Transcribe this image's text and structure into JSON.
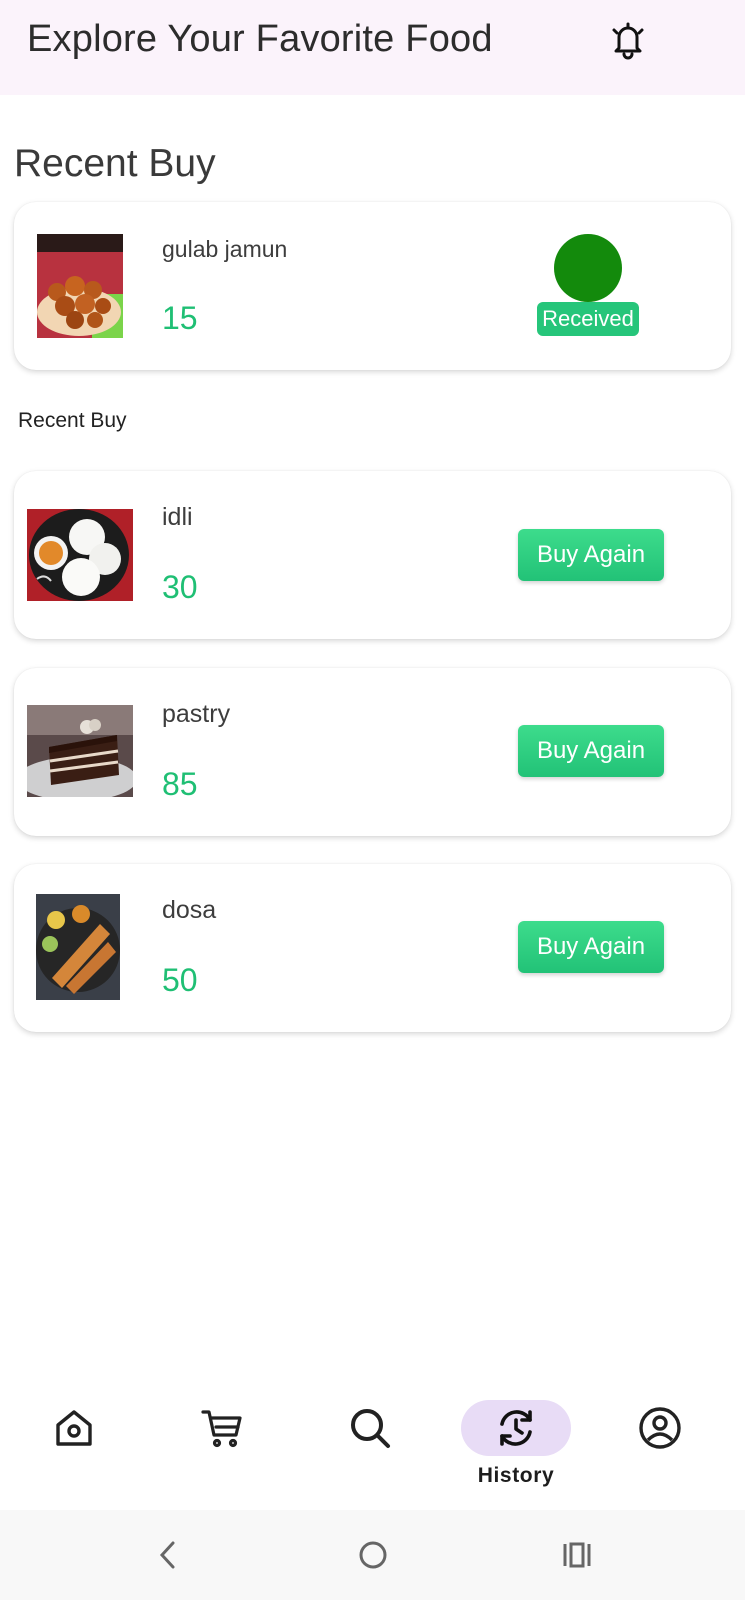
{
  "header": {
    "title": "Explore Your Favorite Food",
    "bell_icon": "bell-icon"
  },
  "recent": {
    "title": "Recent Buy",
    "item": {
      "name": "gulab jamun",
      "price": "15",
      "status": "Received",
      "status_dot_color": "#138a0c"
    }
  },
  "history": {
    "subtitle": "Recent Buy",
    "items": [
      {
        "name": "idli",
        "price": "30",
        "button": "Buy Again"
      },
      {
        "name": "pastry",
        "price": "85",
        "button": "Buy Again"
      },
      {
        "name": "dosa",
        "price": "50",
        "button": "Buy Again"
      }
    ]
  },
  "nav": {
    "items": [
      {
        "icon": "home-icon",
        "label": ""
      },
      {
        "icon": "cart-icon",
        "label": ""
      },
      {
        "icon": "search-icon",
        "label": ""
      },
      {
        "icon": "history-icon",
        "label": "History",
        "active": true
      },
      {
        "icon": "profile-icon",
        "label": ""
      }
    ]
  },
  "system_nav": [
    "back-icon",
    "home-circle-icon",
    "recents-icon"
  ],
  "colors": {
    "accent_green": "#1fbf74",
    "topbar_bg": "#fbf3fb",
    "nav_active_bg": "#e8dcf6"
  }
}
